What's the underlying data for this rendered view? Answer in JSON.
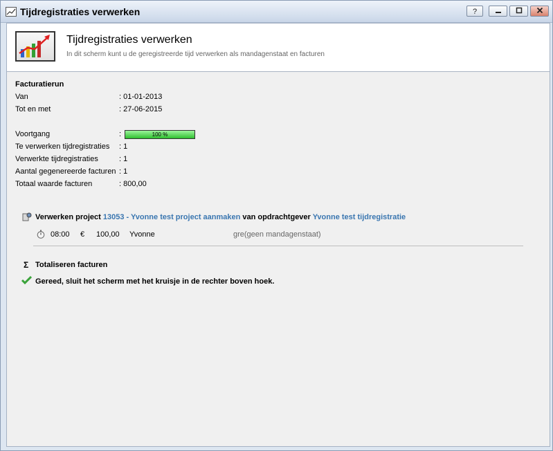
{
  "window": {
    "title": "Tijdregistraties verwerken",
    "buttons": {
      "help": "?",
      "minimize": "_",
      "maximize": "□",
      "close": "✕"
    }
  },
  "header": {
    "title": "Tijdregistraties verwerken",
    "subtitle": "In dit scherm kunt u de geregistreerde tijd verwerken als mandagenstaat en facturen"
  },
  "facturatierun": {
    "heading": "Facturatierun",
    "van_label": "Van",
    "van_value": ": 01-01-2013",
    "tot_label": "Tot en met",
    "tot_value": ": 27-06-2015"
  },
  "stats": {
    "voortgang_label": "Voortgang",
    "voortgang_colon": ":",
    "progress_text": "100 %",
    "progress_value": 100,
    "te_verwerken_label": "Te verwerken tijdregistraties",
    "te_verwerken_value": ": 1",
    "verwerkte_label": "Verwerkte tijdregistraties",
    "verwerkte_value": ": 1",
    "facturen_label": "Aantal gegenereerde facturen",
    "facturen_value": ": 1",
    "totaal_label": "Totaal waarde facturen",
    "totaal_value": ": 800,00"
  },
  "project": {
    "prefix": "Verwerken project",
    "project_link": "13053 - Yvonne test project aanmaken",
    "middle": "van opdrachtgever",
    "client_link": "Yvonne test tijdregistratie",
    "entry": {
      "time": "08:00",
      "currency": "€",
      "amount": "100,00",
      "name": "Yvonne",
      "note": "gre(geen mandagenstaat)"
    }
  },
  "totaliseren": {
    "label": "Totaliseren facturen",
    "icon": "Σ"
  },
  "done": {
    "message": "Gereed, sluit het scherm met het kruisje in de rechter boven hoek."
  }
}
